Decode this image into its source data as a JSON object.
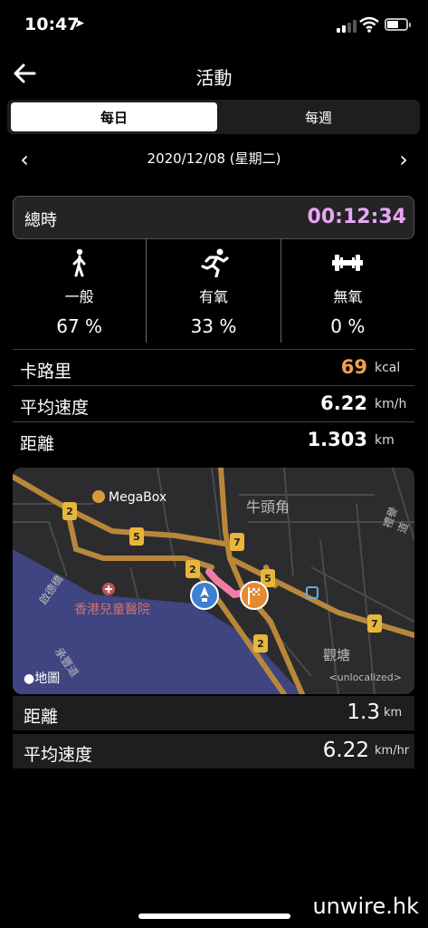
{
  "status_bar": {
    "time": "10:47",
    "location_glyph": "➤"
  },
  "header": {
    "title": "活動",
    "back_icon": "arrow-left-icon"
  },
  "segment": {
    "daily": "每日",
    "weekly": "每週",
    "selected": "每日"
  },
  "date_nav": {
    "date": "2020/12/08 (星期二)",
    "prev": "‹",
    "next": "›"
  },
  "total": {
    "label": "總時",
    "value": "00:12:34",
    "color": "#e7a6f5"
  },
  "activities": [
    {
      "icon": "walking-icon",
      "label": "一般",
      "percent": "67 %"
    },
    {
      "icon": "running-icon",
      "label": "有氧",
      "percent": "33 %"
    },
    {
      "icon": "dumbbell-icon",
      "label": "無氧",
      "percent": "0 %"
    }
  ],
  "stats": {
    "calories": {
      "label": "卡路里",
      "value": "69",
      "unit": "kcal",
      "color": "#f0a050"
    },
    "avg_speed": {
      "label": "平均速度",
      "value": "6.22",
      "unit": "km/h"
    },
    "distance": {
      "label": "距離",
      "value": "1.303",
      "unit": "km"
    }
  },
  "map": {
    "labels": {
      "megabox": "MegaBox",
      "ngau_tau_kok": "牛頭角",
      "hospital": "香港兒童醫院",
      "kwun_tong": "觀塘",
      "bridge": "啟德橋",
      "road2": "承豐道",
      "road3": "禮譽道"
    },
    "route_badges": [
      "2",
      "5",
      "7",
      "2",
      "5",
      "7",
      "2"
    ],
    "apple_maps": "地圖",
    "legal": "<unlocalized>"
  },
  "summary": {
    "distance": {
      "label": "距離",
      "value": "1.3",
      "unit": "km"
    },
    "avg_speed": {
      "label": "平均速度",
      "value": "6.22",
      "unit": "km/hr"
    }
  },
  "watermark": "unwire.hk"
}
